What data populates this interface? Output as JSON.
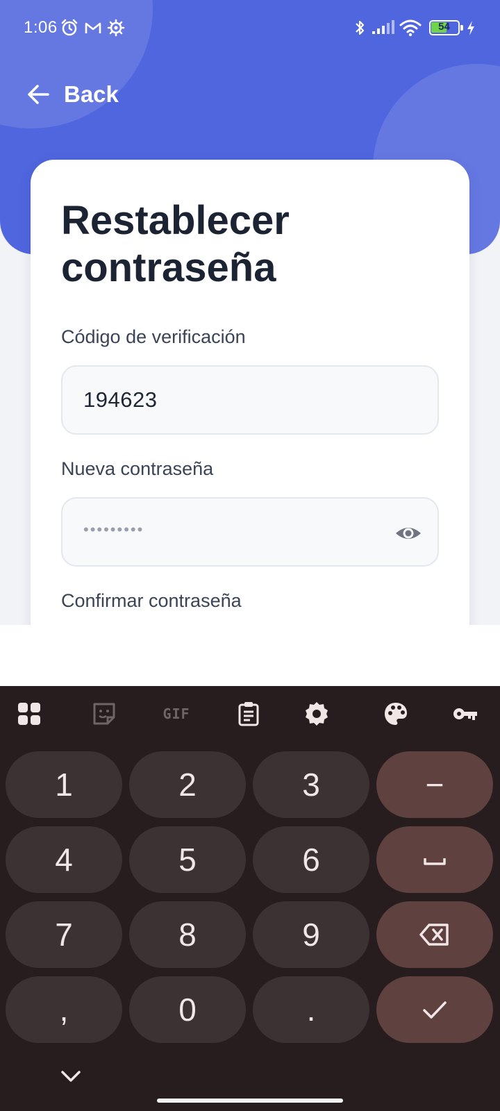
{
  "status_bar": {
    "time": "1:06",
    "battery": "54",
    "icons": [
      "alarm-icon",
      "gmail-icon",
      "settings-icon",
      "bluetooth-icon",
      "signal-icon",
      "wifi-icon",
      "battery-icon",
      "charging-icon"
    ]
  },
  "header": {
    "back_label": "Back"
  },
  "form": {
    "title": "Restablecer contraseña",
    "verification_code": {
      "label": "Código de verificación",
      "value": "194623"
    },
    "new_password": {
      "label": "Nueva contraseña",
      "masked_value": "•••••••••"
    },
    "confirm_password": {
      "label": "Confirmar contraseña"
    }
  },
  "keyboard": {
    "toolbar": [
      "apps-icon",
      "sticker-icon",
      "GIF",
      "clipboard-icon",
      "settings-icon",
      "palette-icon",
      "key-icon"
    ],
    "gif_label": "GIF",
    "keys": [
      "1",
      "2",
      "3",
      "−",
      "4",
      "5",
      "6",
      "␣",
      "7",
      "8",
      "9",
      "⌫",
      ",",
      "0",
      ".",
      "✓"
    ],
    "row1": {
      "k1": "1",
      "k2": "2",
      "k3": "3",
      "k4": "−"
    },
    "row2": {
      "k1": "4",
      "k2": "5",
      "k3": "6"
    },
    "row3": {
      "k1": "7",
      "k2": "8",
      "k3": "9"
    },
    "row4": {
      "k1": ",",
      "k2": "0",
      "k3": "."
    }
  },
  "colors": {
    "header_blue": "#5066de",
    "card_background": "#ffffff",
    "title_text": "#1c2434",
    "keyboard_background": "#281d1e",
    "key_background": "#3d3233",
    "function_key_background": "#5f4140"
  }
}
